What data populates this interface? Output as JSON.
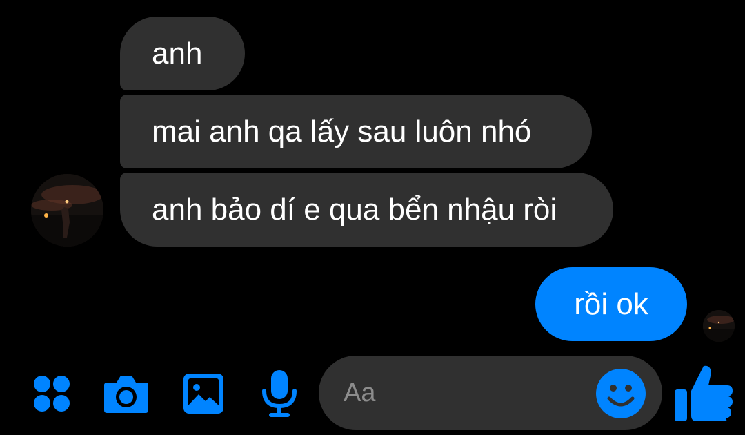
{
  "conversation": {
    "received_messages": [
      {
        "text": "anh"
      },
      {
        "text": "mai anh qa lấy sau luôn nhó"
      },
      {
        "text": "anh bảo dí e qua bển nhậu ròi"
      }
    ],
    "sent_messages": [
      {
        "text": "rồi ok"
      }
    ]
  },
  "composer": {
    "placeholder": "Aa",
    "value": ""
  },
  "toolbar": {
    "icons": [
      "more-apps-icon",
      "camera-icon",
      "gallery-icon",
      "microphone-icon",
      "emoji-icon",
      "thumbs-up-icon"
    ]
  },
  "colors": {
    "background": "#000000",
    "received_bubble": "#303030",
    "sent_bubble": "#0084ff",
    "accent": "#0084ff"
  }
}
